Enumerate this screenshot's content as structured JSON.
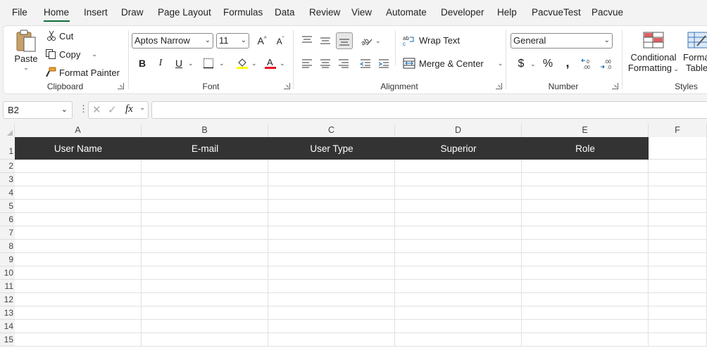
{
  "menu": {
    "items": [
      "File",
      "Home",
      "Insert",
      "Draw",
      "Page Layout",
      "Formulas",
      "Data",
      "Review",
      "View",
      "Automate",
      "Developer",
      "Help",
      "PacvueTest",
      "Pacvue"
    ],
    "active": "Home"
  },
  "clipboard": {
    "paste_label": "Paste",
    "cut_label": "Cut",
    "copy_label": "Copy",
    "format_painter_label": "Format Painter",
    "group_label": "Clipboard"
  },
  "font": {
    "family": "Aptos Narrow",
    "size": "11",
    "bold": "B",
    "italic": "I",
    "underline": "U",
    "group_label": "Font"
  },
  "alignment": {
    "wrap_text_label": "Wrap Text",
    "merge_center_label": "Merge & Center",
    "group_label": "Alignment"
  },
  "number": {
    "format": "General",
    "currency_symbol": "$",
    "percent_symbol": "%",
    "comma_symbol": ",",
    "increase_decimal": ".0←",
    "decrease_decimal": ".00",
    "group_label": "Number"
  },
  "styles": {
    "conditional_formatting_line1": "Conditional",
    "conditional_formatting_line2": "Formatting",
    "format_table_line1": "Format",
    "format_table_line2": "Table",
    "group_label": "Styles"
  },
  "formula_bar": {
    "name_box": "B2",
    "fx_label": "fx",
    "formula": ""
  },
  "sheet": {
    "columns": [
      "A",
      "B",
      "C",
      "D",
      "E",
      "F"
    ],
    "rows": [
      "1",
      "2",
      "3",
      "4",
      "5",
      "6",
      "7",
      "8",
      "9",
      "10",
      "11",
      "12",
      "13",
      "14",
      "15"
    ],
    "header_row": [
      "User Name",
      "E-mail",
      "User Type",
      "Superior",
      "Role"
    ],
    "header_fill": "#333333",
    "header_text_color": "#ffffff"
  },
  "colors": {
    "accent": "#0f6d3a",
    "highlight_yellow": "#ffff00",
    "font_red": "#e81123"
  }
}
